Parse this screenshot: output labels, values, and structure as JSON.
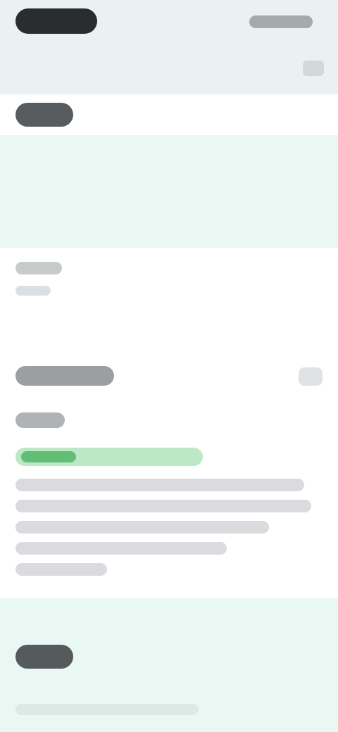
{
  "status_bar": {
    "time": "",
    "indicators": ""
  },
  "header": {
    "title": "",
    "right_action": ""
  },
  "section_1": {
    "header": "",
    "card_content": ""
  },
  "section_2": {
    "primary": "",
    "secondary": ""
  },
  "detail": {
    "title": "",
    "label": "",
    "status_badge": "",
    "paragraph_lines": [
      "",
      "",
      "",
      "",
      ""
    ]
  },
  "bottom_card": {
    "header": "",
    "subtext": ""
  }
}
